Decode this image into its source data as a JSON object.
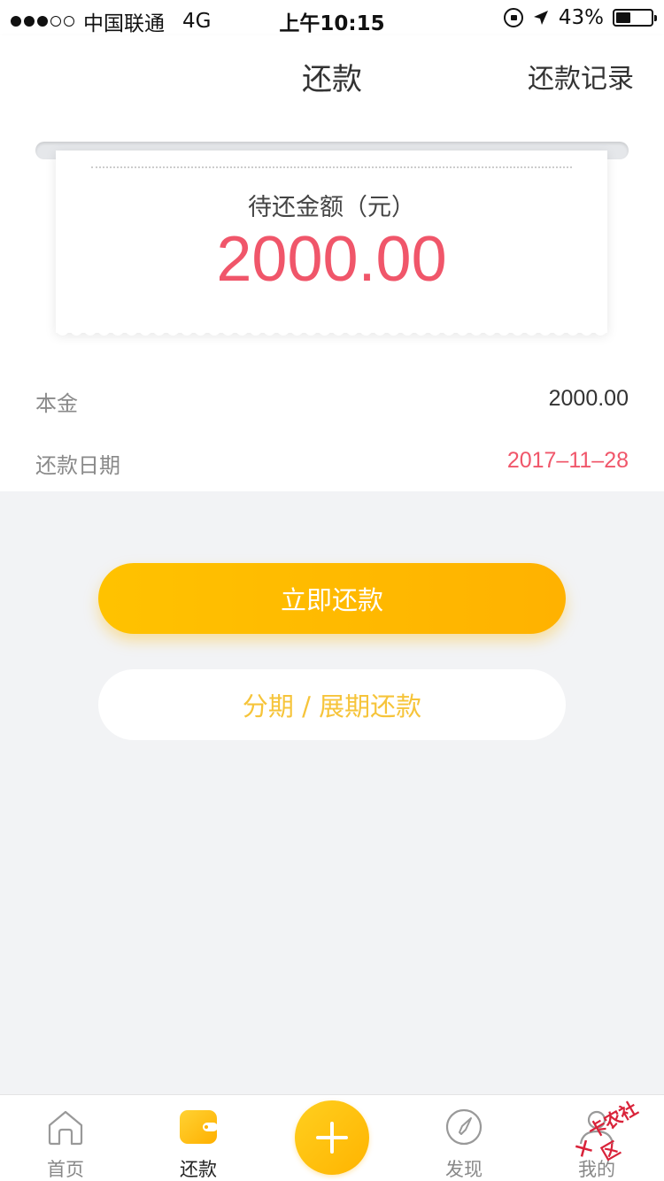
{
  "status_bar": {
    "carrier": "中国联通",
    "network": "4G",
    "time": "上午10:15",
    "battery": "43%",
    "battery_level": 0.43,
    "signal_strength": 3
  },
  "nav": {
    "title": "还款",
    "right_link": "还款记录"
  },
  "receipt": {
    "label": "待还金额（元）",
    "amount": "2000.00"
  },
  "details": {
    "principal_label": "本金",
    "principal_value": "2000.00",
    "date_label": "还款日期",
    "date_value": "2017–11–28"
  },
  "actions": {
    "primary": "立即还款",
    "secondary": "分期 / 展期还款"
  },
  "tabs": [
    {
      "label": "首页",
      "icon": "home-icon"
    },
    {
      "label": "还款",
      "icon": "wallet-icon"
    },
    {
      "label": "",
      "icon": "plus-icon"
    },
    {
      "label": "发现",
      "icon": "compass-icon"
    },
    {
      "label": "我的",
      "icon": "user-icon"
    }
  ],
  "watermark": "卡农社区",
  "colors": {
    "accent": "#ffb800",
    "amount_red": "#f0566a",
    "secondary_text": "#f6c43a"
  }
}
